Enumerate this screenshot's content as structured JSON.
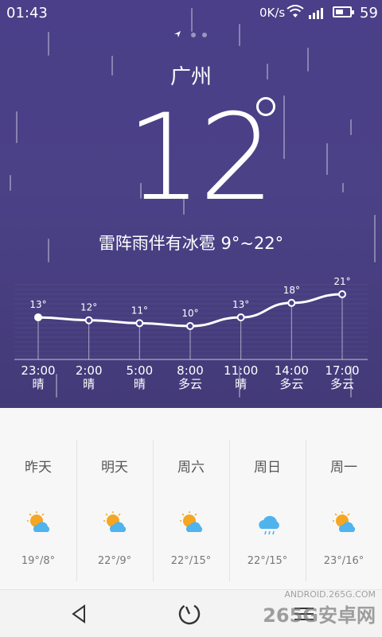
{
  "status_bar": {
    "time": "01:43",
    "net_speed": "0K/s",
    "battery_pct": "59",
    "battery_level": 0.59
  },
  "pager": {
    "pages": 3,
    "current": 0
  },
  "current": {
    "city": "广州",
    "temperature": "12",
    "condition": "雷阵雨伴有冰雹 9°~22°"
  },
  "hourly": {
    "items": [
      {
        "time": "23:00",
        "weather": "晴",
        "temp": 13,
        "temp_label": "13°"
      },
      {
        "time": "2:00",
        "weather": "晴",
        "temp": 12,
        "temp_label": "12°"
      },
      {
        "time": "5:00",
        "weather": "晴",
        "temp": 11,
        "temp_label": "11°"
      },
      {
        "time": "8:00",
        "weather": "多云",
        "temp": 10,
        "temp_label": "10°"
      },
      {
        "time": "11:00",
        "weather": "晴",
        "temp": 13,
        "temp_label": "13°"
      },
      {
        "time": "14:00",
        "weather": "多云",
        "temp": 18,
        "temp_label": "18°"
      },
      {
        "time": "17:00",
        "weather": "多云",
        "temp": 21,
        "temp_label": "21°"
      }
    ]
  },
  "daily": [
    {
      "day": "昨天",
      "icon": "partly-cloudy-icon",
      "range": "19°/8°"
    },
    {
      "day": "明天",
      "icon": "partly-cloudy-icon",
      "range": "22°/9°"
    },
    {
      "day": "周六",
      "icon": "partly-cloudy-icon",
      "range": "22°/15°"
    },
    {
      "day": "周日",
      "icon": "rain-cloud-icon",
      "range": "22°/15°"
    },
    {
      "day": "周一",
      "icon": "partly-cloudy-icon",
      "range": "23°/16°"
    }
  ],
  "watermark": {
    "line1": "ANDROID.265G.COM",
    "line2": "265G安卓网"
  },
  "colors": {
    "hero": "#4a3f88",
    "sun": "#f5a623",
    "cloud": "#4fb3ee"
  }
}
